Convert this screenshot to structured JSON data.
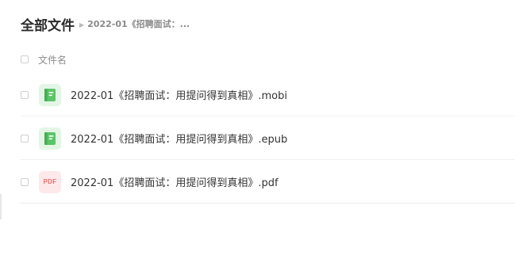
{
  "breadcrumb": {
    "root": "全部文件",
    "separator_icon": "caret-right-icon",
    "current": "2022-01《招聘面试：..."
  },
  "list_header": {
    "column_name": "文件名"
  },
  "files": [
    {
      "name": "2022-01《招聘面试：用提问得到真相》.mobi",
      "icon": "ebook-icon"
    },
    {
      "name": "2022-01《招聘面试：用提问得到真相》.epub",
      "icon": "ebook-icon"
    },
    {
      "name": "2022-01《招聘面试：用提问得到真相》.pdf",
      "icon": "pdf-icon",
      "icon_text": "PDF"
    }
  ],
  "colors": {
    "ebook_icon_bg": "#e3f6e5",
    "ebook_icon_fg": "#5cc468",
    "pdf_icon_bg": "#fde9ea",
    "pdf_icon_fg": "#f26b6b"
  }
}
